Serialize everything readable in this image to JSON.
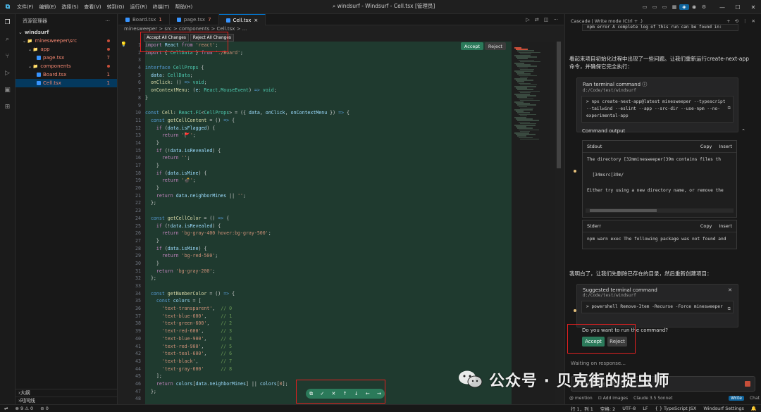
{
  "titlebar": {
    "menus": [
      "文件(F)",
      "编辑(E)",
      "选择(S)",
      "查看(V)",
      "转到(G)",
      "运行(R)",
      "终端(T)",
      "帮助(H)"
    ],
    "search": "windsurf - Windsurf - Cell.tsx [管理员]"
  },
  "sidebar": {
    "title": "资源管理器",
    "root": "windsurf",
    "items": [
      {
        "label": "minesweeper\\src",
        "indent": 10,
        "badge": "dot",
        "type": "folder"
      },
      {
        "label": "app",
        "indent": 18,
        "badge": "dot",
        "type": "folder"
      },
      {
        "label": "page.tsx",
        "indent": 30,
        "badge": "7",
        "type": "file"
      },
      {
        "label": "components",
        "indent": 18,
        "badge": "dot",
        "type": "folder"
      },
      {
        "label": "Board.tsx",
        "indent": 30,
        "badge": "1",
        "type": "file"
      },
      {
        "label": "Cell.tsx",
        "indent": 30,
        "badge": "1",
        "type": "file",
        "selected": true
      }
    ],
    "outline": "大纲",
    "timeline": "时间线"
  },
  "editor": {
    "tabs": [
      {
        "label": "Board.tsx",
        "badge": "1"
      },
      {
        "label": "page.tsx",
        "badge": "7"
      },
      {
        "label": "Cell.tsx",
        "badge": "×",
        "active": true
      }
    ],
    "breadcrumb": "minesweeper > src > components > Cell.tsx > ...",
    "accept_all": "Accept All Changes",
    "reject_all": "Reject All Changes",
    "accept": "Accept",
    "reject": "Reject",
    "line_count": 48
  },
  "panel": {
    "header": "Cascade | Write mode (Ctrl + .)",
    "top_output": "npm error A complete log of this run can be found in:",
    "msg1": "看起来项目初始化过程中出现了一些问题。让我们重新运行create-next-app命令，并确保它完全执行：",
    "ran_title": "Ran terminal command",
    "ran_path": "d:/Code/test/windsurf",
    "ran_cmd": "> npx create-next-app@latest minesweeper --typescript --tailwind --eslint --app --src-dir --use-npm --no-experimental-app",
    "output_title": "Command output",
    "stdout_title": "Stdout",
    "copy": "Copy",
    "insert": "Insert",
    "stdout_lines": [
      "The directory [32mminesweeper[39m contains files th",
      "",
      "  [34msrc[39m/",
      "",
      "Either try using a new directory name, or remove the"
    ],
    "stderr_title": "Stderr",
    "stderr_line": "npm warn exec The following package was not found and",
    "msg2": "我明白了，让我们先删除已存在的目录，然后重新创建项目：",
    "suggest_title": "Suggested terminal command",
    "suggest_path": "d:/Code/test/windsurf",
    "suggest_cmd": "> powershell Remove-Item -Recurse -Force minesweeper",
    "question": "Do you want to run the command?",
    "accept": "Accept",
    "reject": "Reject",
    "waiting": "Waiting on response...",
    "input_placeholder": "Ask anything (Ctrl+L)",
    "footer": {
      "mention": "@ mention",
      "images": "Add images",
      "model": "Claude 3.5 Sonnet",
      "write": "Write",
      "chat": "Chat"
    }
  },
  "status": {
    "errors": "⊗ 9 ⚠ 0",
    "ports": "⊘ 0",
    "position": "行 1，列 1",
    "spaces": "空格: 2",
    "encoding": "UTF-8",
    "eol": "LF",
    "lang": "{ } TypeScript JSX",
    "app": "Windsurf Settings"
  },
  "watermark": "公众号 · 贝克街的捉虫师"
}
